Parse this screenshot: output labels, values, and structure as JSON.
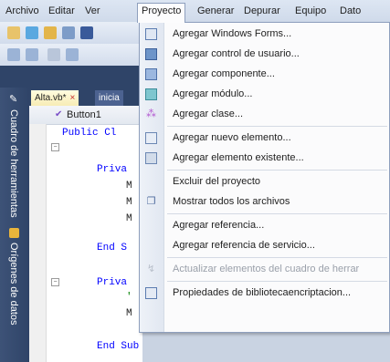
{
  "menubar": {
    "items": [
      "Archivo",
      "Editar",
      "Ver",
      "Proyecto",
      "Generar",
      "Depurar",
      "Equipo",
      "Dato"
    ]
  },
  "tabs": {
    "active": "Alta.vb*",
    "close": "×",
    "inactive": "inicia"
  },
  "navbar": {
    "member": "Button1"
  },
  "code": {
    "line1": "Public Cl",
    "line2": "Priva",
    "line3": "M",
    "line4": "M",
    "line5": "M",
    "line6": "End S",
    "line7": "Priva",
    "line8": "'",
    "line9": "M",
    "line10": "End Sub"
  },
  "sidebar": {
    "toolbox": "Cuadro de herramientas",
    "datasources": "Orígenes de datos"
  },
  "dropdown": {
    "items": [
      {
        "label": "Agregar Windows Forms...",
        "icon": "windows-form-icon"
      },
      {
        "label": "Agregar control de usuario...",
        "icon": "user-control-icon"
      },
      {
        "label": "Agregar componente...",
        "icon": "component-icon"
      },
      {
        "label": "Agregar módulo...",
        "icon": "module-icon"
      },
      {
        "label": "Agregar clase...",
        "icon": "class-icon"
      },
      {
        "label": "Agregar nuevo elemento...",
        "icon": "new-item-icon"
      },
      {
        "label": "Agregar elemento existente...",
        "icon": "existing-item-icon"
      },
      {
        "label": "Excluir del proyecto",
        "icon": ""
      },
      {
        "label": "Mostrar todos los archivos",
        "icon": "show-all-files-icon"
      },
      {
        "label": "Agregar referencia...",
        "icon": ""
      },
      {
        "label": "Agregar referencia de servicio...",
        "icon": ""
      },
      {
        "label": "Actualizar elementos del cuadro de herrar",
        "icon": "refresh-toolbox-icon",
        "disabled": true
      },
      {
        "label": "Propiedades de bibliotecaencriptacion...",
        "icon": "properties-icon"
      }
    ]
  },
  "colors": {
    "accent": "#2f4468",
    "menu_background": "#fbfbfc",
    "keyword": "#0000ff"
  }
}
